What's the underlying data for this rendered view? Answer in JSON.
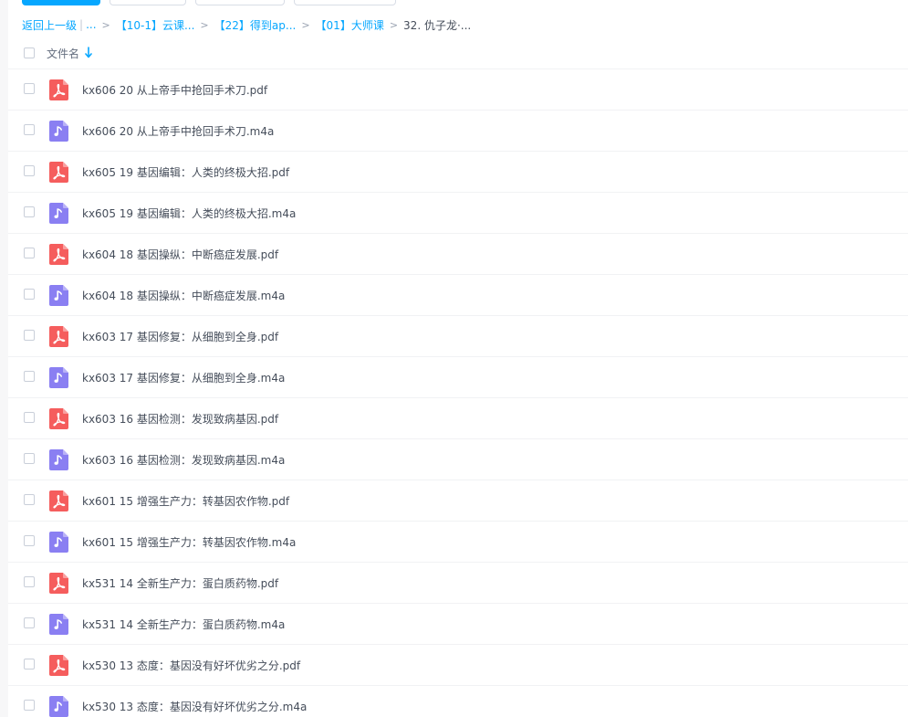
{
  "colors": {
    "accent": "#06a7ff",
    "pdf_icon": "#f55d5d",
    "audio_icon": "#8a7ff2"
  },
  "breadcrumb": {
    "back_label": "返回上一级",
    "ellipsis": "...",
    "items": [
      "【10-1】云课...",
      "【22】得到ap...",
      "【01】大师课"
    ],
    "current": "32. 仇子龙·..."
  },
  "list_header": {
    "column_label": "文件名"
  },
  "files": [
    {
      "name": "kx606 20 从上帝手中抢回手术刀.pdf",
      "type": "pdf"
    },
    {
      "name": "kx606 20 从上帝手中抢回手术刀.m4a",
      "type": "audio"
    },
    {
      "name": "kx605 19 基因编辑：人类的终极大招.pdf",
      "type": "pdf"
    },
    {
      "name": "kx605 19 基因编辑：人类的终极大招.m4a",
      "type": "audio"
    },
    {
      "name": "kx604 18 基因操纵：中断癌症发展.pdf",
      "type": "pdf"
    },
    {
      "name": "kx604 18 基因操纵：中断癌症发展.m4a",
      "type": "audio"
    },
    {
      "name": "kx603 17 基因修复：从细胞到全身.pdf",
      "type": "pdf"
    },
    {
      "name": "kx603 17 基因修复：从细胞到全身.m4a",
      "type": "audio"
    },
    {
      "name": "kx603 16 基因检测：发现致病基因.pdf",
      "type": "pdf"
    },
    {
      "name": "kx603 16 基因检测：发现致病基因.m4a",
      "type": "audio"
    },
    {
      "name": "kx601 15 增强生产力：转基因农作物.pdf",
      "type": "pdf"
    },
    {
      "name": "kx601 15 增强生产力：转基因农作物.m4a",
      "type": "audio"
    },
    {
      "name": "kx531 14 全新生产力：蛋白质药物.pdf",
      "type": "pdf"
    },
    {
      "name": "kx531 14 全新生产力：蛋白质药物.m4a",
      "type": "audio"
    },
    {
      "name": "kx530 13 态度：基因没有好坏优劣之分.pdf",
      "type": "pdf"
    },
    {
      "name": "kx530 13 态度：基因没有好坏优劣之分.m4a",
      "type": "audio"
    }
  ]
}
